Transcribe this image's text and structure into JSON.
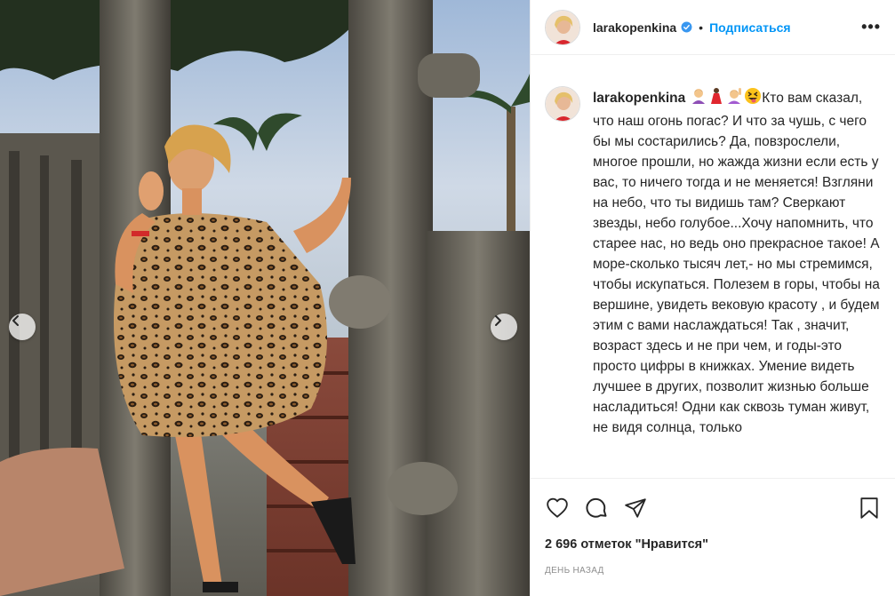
{
  "header": {
    "username": "larakopenkina",
    "separator": "•",
    "follow_label": "Подписаться",
    "more_label": "•••"
  },
  "caption": {
    "username": "larakopenkina",
    "emoji_icons": [
      "woman-gesturing-ok-icon",
      "woman-dancing-icon",
      "woman-raising-hand-icon",
      "squinting-face-with-tongue-icon"
    ],
    "text": "Кто вам сказал, что наш огонь погас? И что за чушь, с чего бы мы состарились? Да, повзрослели, многое прошли, но жажда жизни если есть у вас, то ничего тогда и не меняется! Взгляни на небо, что ты видишь там? Сверкают звезды, небо голубое...Хочу напомнить, что старее нас, но ведь оно прекрасное такое! А море-сколько тысяч лет,- но мы стремимся, чтобы искупаться. Полезем в горы, чтобы на вершине, увидеть вековую красоту , и будем этим с вами наслаждаться! Так , значит, возраст здесь и не при чем, и годы-это просто цифры в книжках. Умение видеть лучшее в других, позволит жизнью больше насладиться! Одни как сквозь туман живут, не видя солнца, только"
  },
  "actions": {
    "icons": [
      "heart-icon",
      "comment-icon",
      "share-icon",
      "bookmark-icon"
    ]
  },
  "likes_text": "2 696 отметок \"Нравится\"",
  "time_ago": "ДЕНЬ НАЗАД",
  "colors": {
    "link_blue": "#0095f6",
    "verified_blue": "#3897f0",
    "text": "#262626",
    "muted": "#8e8e8e",
    "border": "#efefef"
  }
}
